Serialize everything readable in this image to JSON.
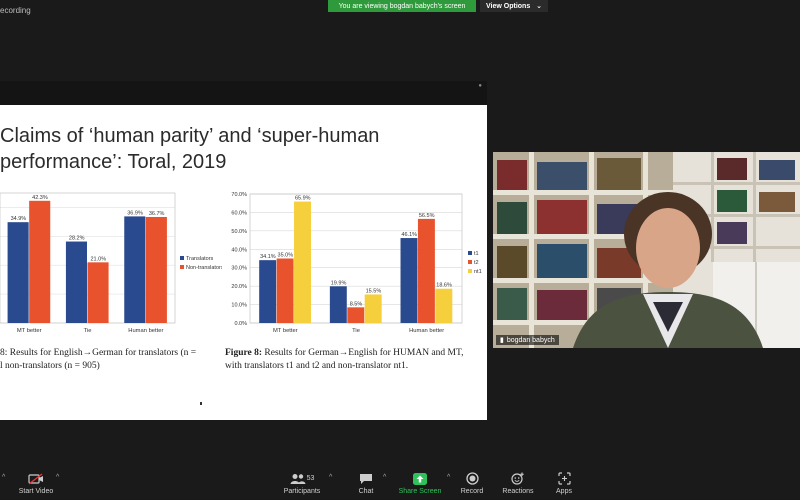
{
  "top": {
    "recording": "ecording",
    "banner": "You are viewing bogdan babych's screen",
    "view_options": "View Options"
  },
  "slide": {
    "title_line1": "Claims of ‘human parity’ and ‘super-human",
    "title_line2": "performance’: Toral, 2019",
    "left_caption_line1": "8: Results for English→German for translators (n =",
    "left_caption_line2": "l non-translators (n = 905)",
    "right_caption_bold": "Figure 8:",
    "right_caption_line1": " Results for German→English for HUMAN and MT,",
    "right_caption_line2": "with translators t1 and t2 and non-translator nt1."
  },
  "chart_data": [
    {
      "type": "bar",
      "categories": [
        "MT better",
        "Tie",
        "Human better"
      ],
      "series": [
        {
          "name": "Translators",
          "values": [
            34.9,
            28.2,
            36.9
          ],
          "labels": [
            "34.9%",
            "28.2%",
            "36.9%"
          ],
          "color": "#2a4a8f"
        },
        {
          "name": "Non-translators",
          "values": [
            42.3,
            21.0,
            36.7
          ],
          "labels": [
            "42.3%",
            "21.0%",
            "36.7%"
          ],
          "color": "#e8532e"
        }
      ],
      "ylim": [
        0,
        45
      ],
      "legend": "right"
    },
    {
      "type": "bar",
      "categories": [
        "MT better",
        "Tie",
        "Human better"
      ],
      "series": [
        {
          "name": "t1",
          "values": [
            34.1,
            19.9,
            46.1
          ],
          "labels": [
            "34.1%",
            "19.9%",
            "46.1%"
          ],
          "color": "#2a4a8f"
        },
        {
          "name": "t2",
          "values": [
            35.0,
            8.5,
            56.5
          ],
          "labels": [
            "35.0%",
            "8.5%",
            "56.5%"
          ],
          "color": "#e8532e"
        },
        {
          "name": "nt1",
          "values": [
            65.9,
            15.5,
            18.6
          ],
          "labels": [
            "65.9%",
            "15.5%",
            "18.6%"
          ],
          "color": "#f5cf3c"
        }
      ],
      "yticks": [
        "0.0%",
        "10.0%",
        "20.0%",
        "30.0%",
        "40.0%",
        "50.0%",
        "60.0%",
        "70.0%"
      ],
      "ylim": [
        0,
        70
      ],
      "legend": "right"
    }
  ],
  "video": {
    "name": "bogdan babych"
  },
  "toolbar": {
    "start_video": "Start Video",
    "participants": "Participants",
    "participants_count": "53",
    "chat": "Chat",
    "share_screen": "Share Screen",
    "record": "Record",
    "reactions": "Reactions",
    "apps": "Apps"
  },
  "colors": {
    "banner": "#2f9a3c",
    "share_screen": "#2fc25b"
  }
}
